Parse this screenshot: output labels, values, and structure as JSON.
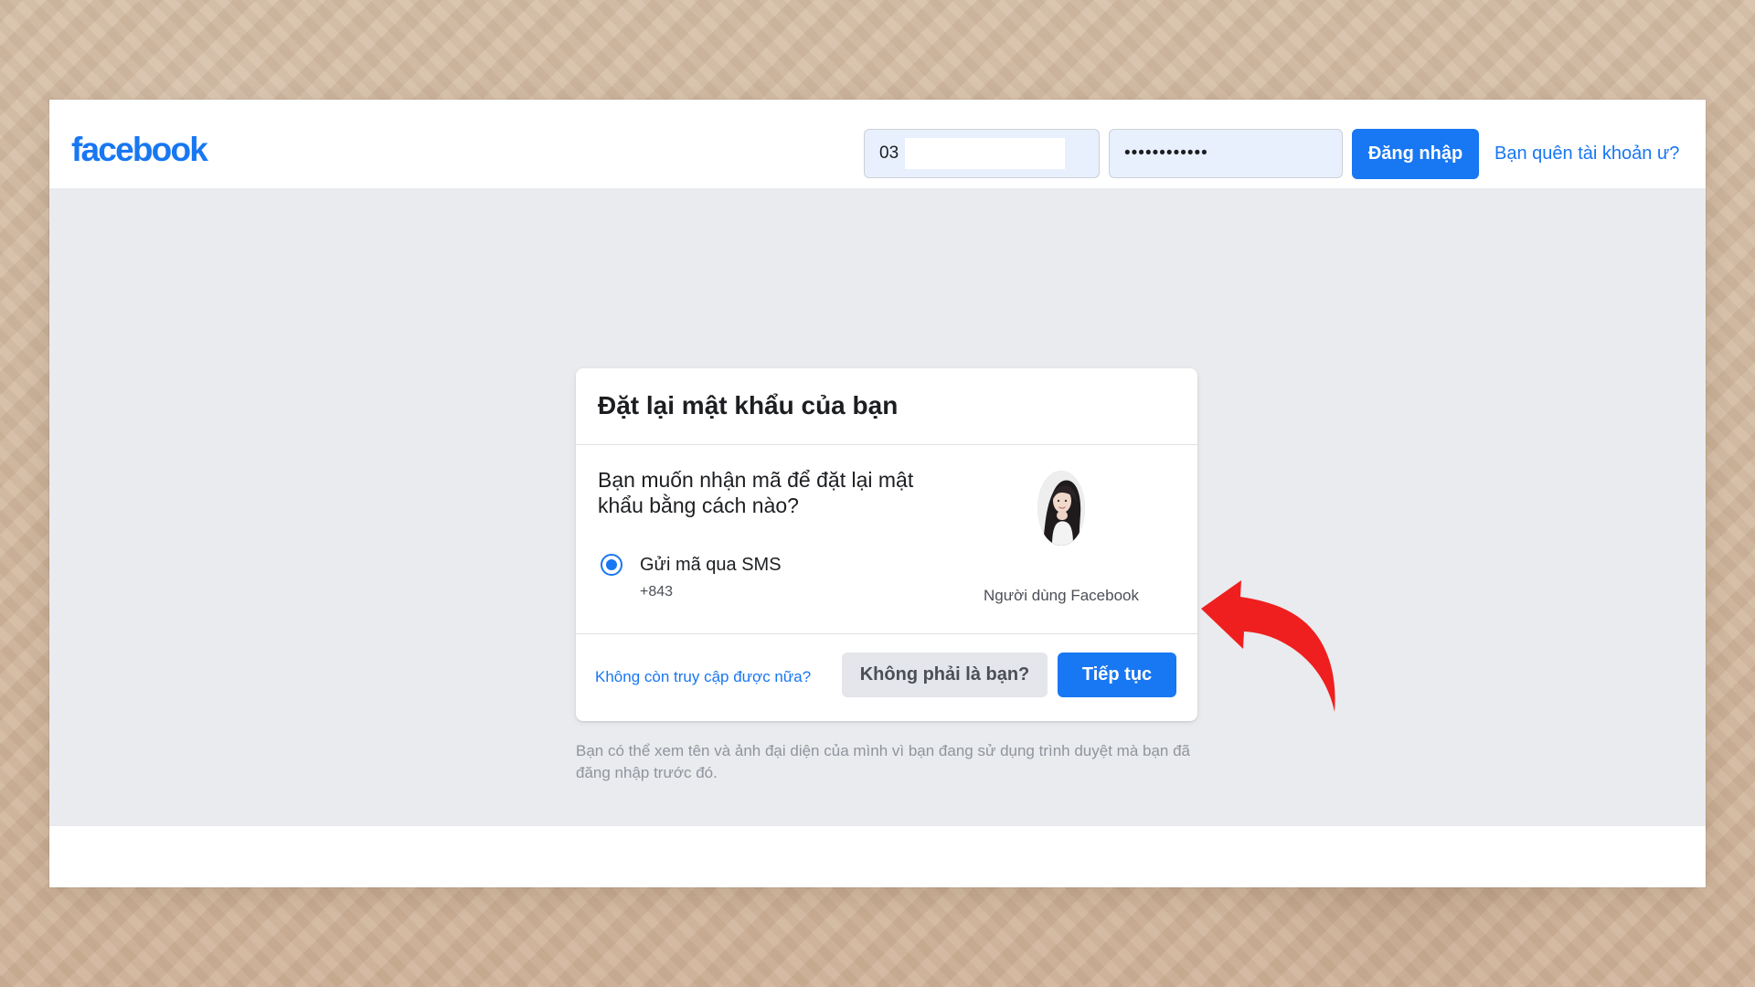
{
  "header": {
    "logo": "facebook",
    "phone_value": "03",
    "password_value": "••••••••••••",
    "login_label": "Đăng nhập",
    "forgot_label": "Bạn quên tài khoản ư?"
  },
  "dialog": {
    "title": "Đặt lại mật khẩu của bạn",
    "question": "Bạn muốn nhận mã để đặt lại mật khẩu bằng cách nào?",
    "sms_option_label": "Gửi mã qua SMS",
    "sms_number": "+843",
    "profile_caption": "Người dùng Facebook",
    "no_access_link": "Không còn truy cập được nữa?",
    "not_you_label": "Không phải là bạn?",
    "continue_label": "Tiếp tục"
  },
  "help_text": "Bạn có thể xem tên và ảnh đại diện của mình vì bạn đang sử dụng trình duyệt mà bạn đã đăng nhập trước đó.",
  "icons": {
    "radio": "radio-selected-icon",
    "avatar": "profile-avatar-icon",
    "arrow": "pointer-arrow-icon"
  },
  "colors": {
    "brand": "#1877f2",
    "page_bg": "#e9ebee",
    "text": "#1c1e21",
    "muted": "#90949c",
    "secondary_button": "#e4e6eb",
    "arrow": "#ef1f1f"
  }
}
